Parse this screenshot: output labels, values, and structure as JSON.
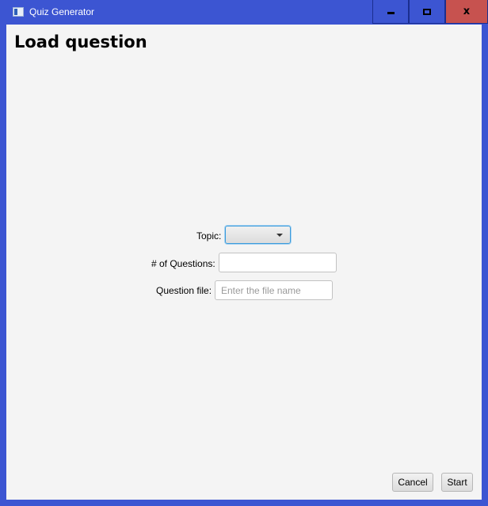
{
  "window": {
    "title": "Quiz Generator",
    "controls": {
      "minimize": "minimize",
      "maximize": "maximize",
      "close": "x"
    }
  },
  "page": {
    "heading": "Load question"
  },
  "form": {
    "topic": {
      "label": "Topic:",
      "selected": ""
    },
    "num_questions": {
      "label": "# of Questions:",
      "value": "",
      "placeholder": ""
    },
    "question_file": {
      "label": "Question file:",
      "value": "",
      "placeholder": "Enter the file name"
    }
  },
  "buttons": {
    "cancel": "Cancel",
    "start": "Start"
  },
  "colors": {
    "title_bar": "#3c55d2",
    "close_button": "#c7524f",
    "client_background": "#f4f4f4",
    "focus_ring": "#3a9bdc"
  },
  "icons": {
    "app": "window-app-icon",
    "minimize": "minimize-icon",
    "maximize": "maximize-icon",
    "close": "close-icon",
    "dropdown": "chevron-down-icon"
  }
}
